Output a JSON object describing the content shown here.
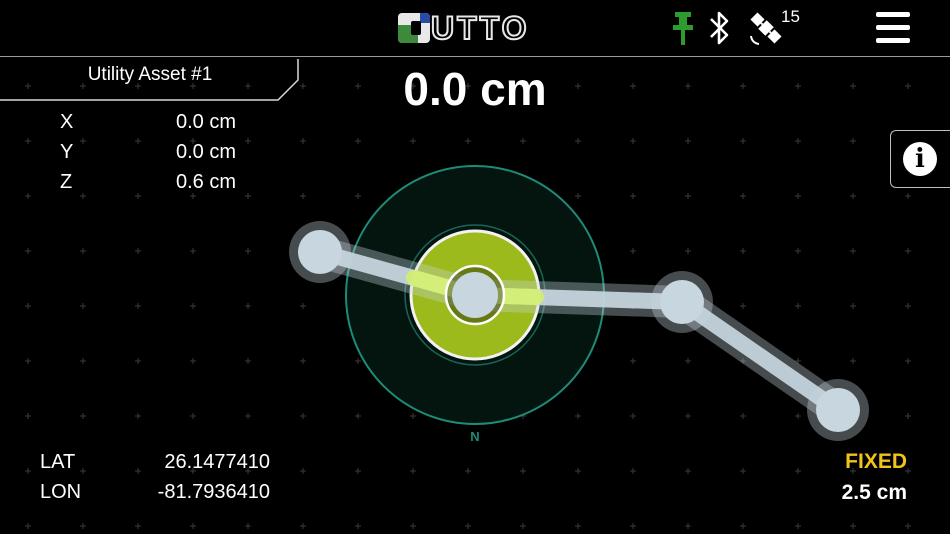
{
  "header": {
    "logo_text": "UTTO",
    "satellite_count": "15",
    "icons": {
      "pin": "map-pin-icon",
      "bluetooth": "bluetooth-icon",
      "satellite": "satellite-icon",
      "menu": "hamburger-menu-icon"
    },
    "pin_color": "#2e9b2e"
  },
  "asset": {
    "title": "Utility Asset #1",
    "distance": "0.0 cm",
    "coords": [
      {
        "label": "X",
        "value": "0.0 cm"
      },
      {
        "label": "Y",
        "value": "0.0 cm"
      },
      {
        "label": "Z",
        "value": "0.6 cm"
      }
    ]
  },
  "info_button": {
    "glyph": "i"
  },
  "compass": {
    "north_label": "N",
    "ring_color": "#1f8a78",
    "target_color": "#9dba1c"
  },
  "location": {
    "lat_label": "LAT",
    "lat_value": "26.1477410",
    "lon_label": "LON",
    "lon_value": "-81.7936410"
  },
  "fix": {
    "status": "FIXED",
    "status_color": "#f0c419",
    "accuracy": "2.5 cm"
  }
}
